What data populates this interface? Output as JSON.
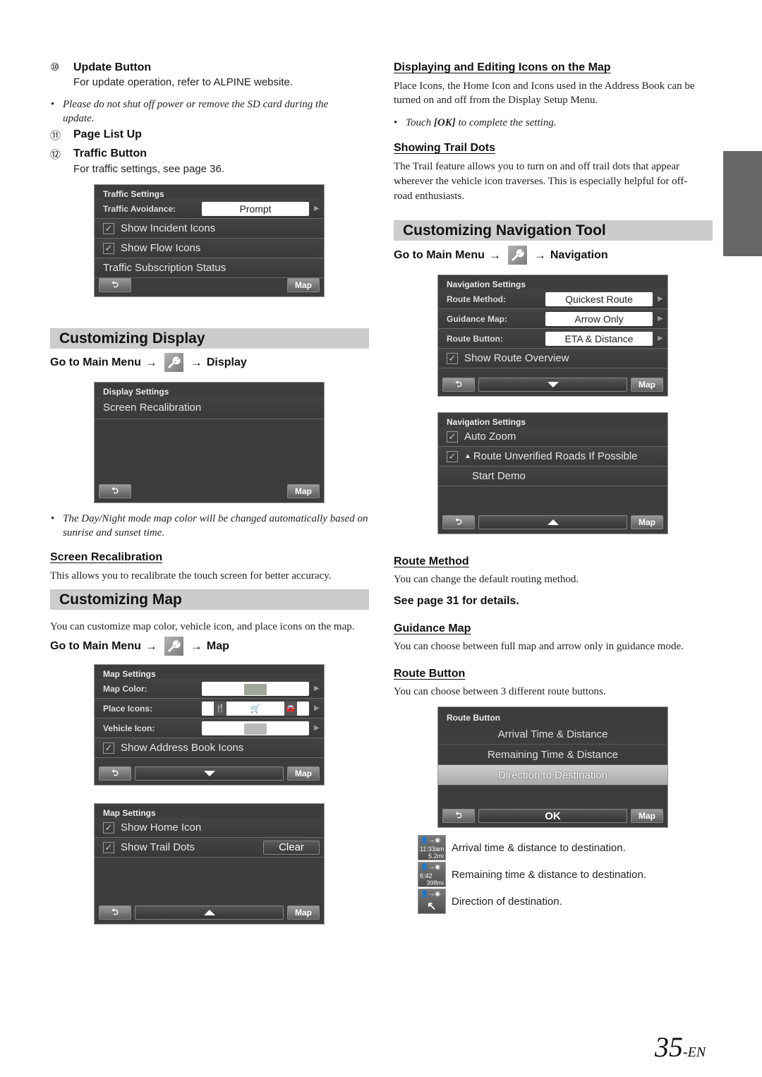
{
  "left": {
    "items": [
      {
        "num": "⑩",
        "title": "Update Button",
        "desc": "For update operation, refer to ALPINE website."
      },
      {
        "num": "⑪",
        "title": "Page List Up"
      },
      {
        "num": "⑫",
        "title": "Traffic Button",
        "desc": "For traffic settings, see page 36."
      }
    ],
    "update_note": "Please do not shut off power or remove the SD card during the update.",
    "traffic_screen": {
      "title": "Traffic Settings",
      "avoidance_label": "Traffic Avoidance:",
      "avoidance_value": "Prompt",
      "rows": [
        "Show Incident Icons",
        "Show Flow Icons"
      ],
      "subscription": "Traffic Subscription Status",
      "map_label": "Map"
    },
    "display_section": {
      "title": "Customizing Display",
      "go_prefix": "Go to Main Menu",
      "go_target": "Display",
      "screen": {
        "title": "Display Settings",
        "row": "Screen Recalibration",
        "map_label": "Map"
      },
      "note": "The Day/Night mode map color will be changed automatically based on sunrise and sunset time.",
      "recal_heading": "Screen Recalibration",
      "recal_desc": "This allows you to recalibrate the touch screen for better accuracy."
    },
    "map_section": {
      "title": "Customizing Map",
      "desc": "You can customize map color, vehicle icon, and place icons on the map.",
      "go_prefix": "Go to Main Menu",
      "go_target": "Map",
      "screen1": {
        "title": "Map Settings",
        "rows": [
          "Map Color:",
          "Place Icons:",
          "Vehicle Icon:"
        ],
        "check_row": "Show Address Book Icons",
        "map_label": "Map"
      },
      "screen2": {
        "title": "Map Settings",
        "rows": [
          "Show Home Icon",
          "Show Trail Dots"
        ],
        "clear_label": "Clear",
        "map_label": "Map"
      }
    }
  },
  "right": {
    "icons_heading": "Displaying and Editing Icons on the Map",
    "icons_desc": "Place Icons, the Home Icon and Icons used in the Address Book can be turned on and off from the Display Setup Menu.",
    "icons_note_pre": "Touch ",
    "icons_note_ok": "[OK]",
    "icons_note_post": " to complete the setting.",
    "trail_heading": "Showing Trail Dots",
    "trail_desc": "The Trail feature allows you to turn on and off trail dots that appear wherever the vehicle icon traverses. This is especially helpful for off-road enthusiasts.",
    "nav_section": {
      "title": "Customizing Navigation Tool",
      "go_prefix": "Go to Main Menu",
      "go_target": "Navigation",
      "screen1": {
        "title": "Navigation Settings",
        "rows": [
          {
            "label": "Route Method:",
            "value": "Quickest Route"
          },
          {
            "label": "Guidance Map:",
            "value": "Arrow Only"
          },
          {
            "label": "Route Button:",
            "value": "ETA & Distance"
          }
        ],
        "check_row": "Show Route Overview",
        "map_label": "Map"
      },
      "screen2": {
        "title": "Navigation Settings",
        "rows": [
          "Auto Zoom",
          "Route Unverified Roads If Possible"
        ],
        "demo": "Start Demo",
        "map_label": "Map"
      }
    },
    "route_method_heading": "Route Method",
    "route_method_desc": "You can change the default routing method.",
    "see_page": "See page 31 for details.",
    "guidance_heading": "Guidance Map",
    "guidance_desc": "You can choose between full map and arrow only in guidance mode.",
    "route_button_heading": "Route Button",
    "route_button_desc": "You can choose between 3 different route buttons.",
    "route_screen": {
      "title": "Route Button",
      "options": [
        "Arrival Time & Distance",
        "Remaining Time & Distance",
        "Direction to Destination"
      ],
      "selected": 2,
      "ok_label": "OK",
      "map_label": "Map"
    },
    "legend": [
      {
        "icon_line1": "11:33am",
        "icon_line2": "5.2mi",
        "text": "Arrival time & distance to destination."
      },
      {
        "icon_line1": "6:42",
        "icon_line2": "398mi",
        "text": "Remaining time & distance to destination."
      },
      {
        "icon_line1": "↖",
        "icon_line2": "",
        "text": "Direction of destination."
      }
    ]
  },
  "footer": {
    "page": "35",
    "suffix": "-EN"
  }
}
